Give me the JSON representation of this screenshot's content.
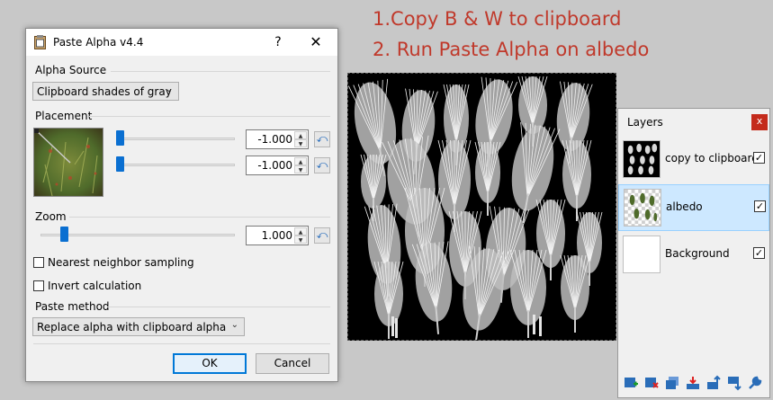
{
  "annotation": {
    "line1": "1.Copy B & W to clipboard",
    "line2": "2.  Run Paste Alpha on albedo"
  },
  "dialog": {
    "title": "Paste Alpha v4.4",
    "help_label": "?",
    "close_label": "✕",
    "alpha_source": {
      "label": "Alpha Source",
      "selected": "Clipboard shades of gray"
    },
    "placement": {
      "label": "Placement",
      "x_value": "-1.000",
      "y_value": "-1.000",
      "x_slider_fraction": 0.0,
      "y_slider_fraction": 0.0
    },
    "zoom": {
      "label": "Zoom",
      "value": "1.000",
      "slider_fraction": 0.12
    },
    "nearest_neighbor": {
      "label": "Nearest neighbor sampling",
      "checked": false
    },
    "invert": {
      "label": "Invert calculation",
      "checked": false
    },
    "paste_method": {
      "label": "Paste method",
      "selected": "Replace alpha with clipboard alpha"
    },
    "ok_label": "OK",
    "cancel_label": "Cancel",
    "reset_glyph": "⤺",
    "spin_up": "▲",
    "spin_down": "▼",
    "dropdown_glyph": "⌄"
  },
  "layers_panel": {
    "title": "Layers",
    "close_label": "x",
    "items": [
      {
        "name": "copy to clipboard",
        "visible": true,
        "selected": false
      },
      {
        "name": "albedo",
        "visible": true,
        "selected": true
      },
      {
        "name": "Background",
        "visible": true,
        "selected": false
      }
    ],
    "check_glyph": "✓",
    "toolbar_icons": [
      "add-layer-icon",
      "delete-layer-icon",
      "duplicate-layer-icon",
      "merge-down-icon",
      "move-up-icon",
      "move-down-icon",
      "properties-icon"
    ]
  },
  "colors": {
    "annotation": "#c0392b",
    "accent": "#0078d7",
    "slider_thumb": "#0a6fd1"
  }
}
